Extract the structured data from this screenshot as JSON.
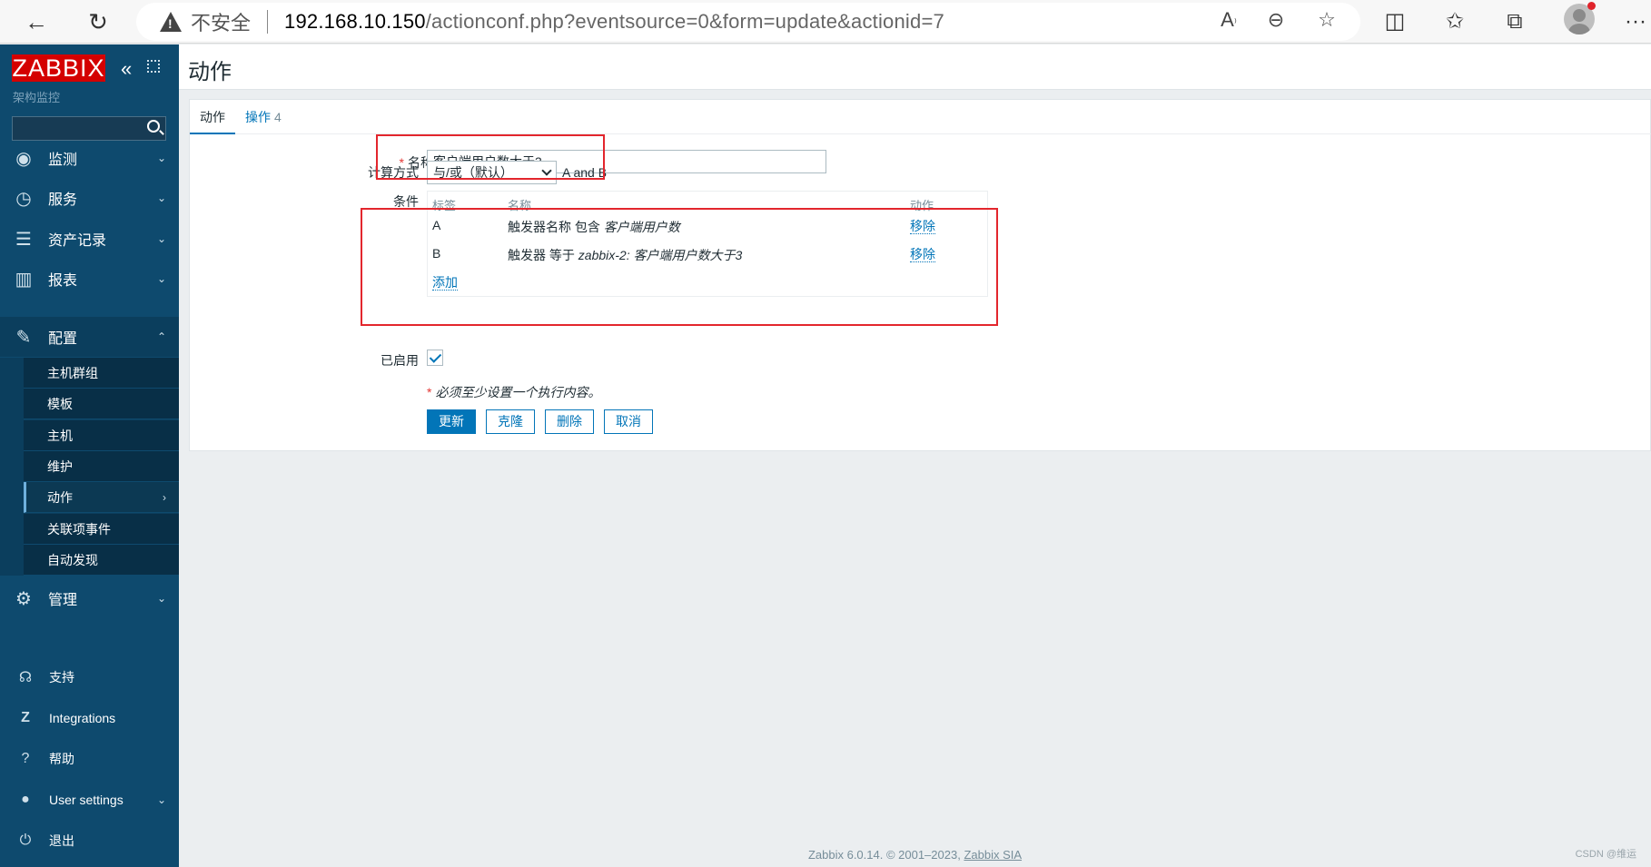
{
  "browser": {
    "insecure_label": "不安全",
    "url_host": "192.168.10.150",
    "url_path": "/actionconf.php?eventsource=0&form=update&actionid=7"
  },
  "sidebar": {
    "logo": "ZABBIX",
    "subtitle": "架构监控",
    "menu": [
      {
        "label": "监测",
        "icon": "eye-icon"
      },
      {
        "label": "服务",
        "icon": "clock-icon"
      },
      {
        "label": "资产记录",
        "icon": "list-icon"
      },
      {
        "label": "报表",
        "icon": "chart-icon"
      },
      {
        "label": "配置",
        "icon": "wrench-icon"
      }
    ],
    "submenu": [
      "主机群组",
      "模板",
      "主机",
      "维护",
      "动作",
      "关联项事件",
      "自动发现"
    ],
    "admin": {
      "label": "管理",
      "icon": "gear-icon"
    },
    "bottom": [
      {
        "label": "支持",
        "icon": "headset-icon"
      },
      {
        "label": "Integrations",
        "icon": "z-icon"
      },
      {
        "label": "帮助",
        "icon": "question-icon"
      },
      {
        "label": "User settings",
        "icon": "user-icon"
      },
      {
        "label": "退出",
        "icon": "power-icon"
      }
    ]
  },
  "page": {
    "title": "动作"
  },
  "tabs": {
    "action": "动作",
    "operations": "操作",
    "operations_count": "4"
  },
  "form": {
    "name_label": "名称",
    "name_value": "客户端用户数大于3",
    "calc_label": "计算方式",
    "calc_value": "与/或（默认）",
    "calc_formula": "A and B",
    "conditions_label": "条件",
    "conditions_headers": {
      "tag": "标签",
      "name": "名称",
      "action": "动作"
    },
    "conditions": [
      {
        "tag": "A",
        "text_prefix": "触发器名称 包含 ",
        "text_value": "客户端用户数",
        "remove": "移除"
      },
      {
        "tag": "B",
        "text_prefix": "触发器 等于 ",
        "text_value": "zabbix-2: 客户端用户数大于3",
        "remove": "移除"
      }
    ],
    "add_link": "添加",
    "enabled_label": "已启用",
    "enabled": true,
    "note": "必须至少设置一个执行内容。",
    "buttons": {
      "update": "更新",
      "clone": "克隆",
      "delete": "删除",
      "cancel": "取消"
    }
  },
  "footer": {
    "text": "Zabbix 6.0.14. © 2001–2023, ",
    "link": "Zabbix SIA"
  },
  "watermark": "CSDN @维运",
  "colors": {
    "accent": "#0275b8",
    "sidebar": "#0e4a6e",
    "logo": "#d40000",
    "highlight": "#e3262d"
  }
}
